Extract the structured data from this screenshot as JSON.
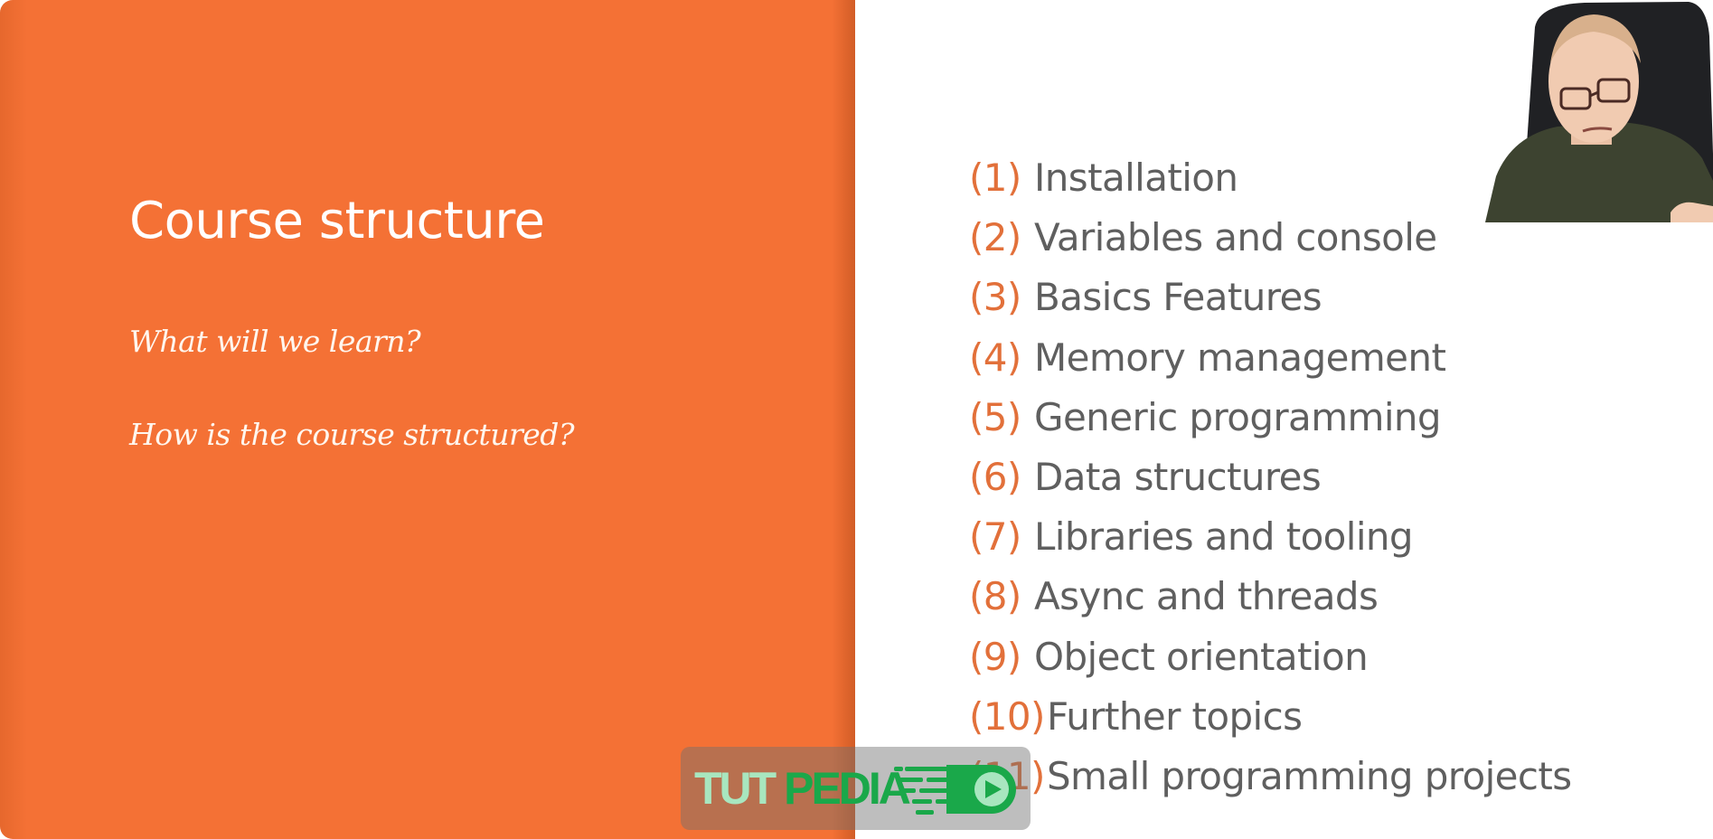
{
  "slide": {
    "title": "Course structure",
    "questions": [
      "What will we learn?",
      "How is the course structured?"
    ],
    "topics": [
      {
        "num": "(1)",
        "label": "Installation"
      },
      {
        "num": "(2)",
        "label": "Variables and console"
      },
      {
        "num": "(3)",
        "label": "Basics Features"
      },
      {
        "num": "(4)",
        "label": "Memory management"
      },
      {
        "num": "(5)",
        "label": "Generic programming"
      },
      {
        "num": "(6)",
        "label": "Data structures"
      },
      {
        "num": "(7)",
        "label": "Libraries and tooling"
      },
      {
        "num": "(8)",
        "label": "Async and threads"
      },
      {
        "num": "(9)",
        "label": "Object orientation"
      },
      {
        "num": "(10)",
        "label": "Further topics"
      },
      {
        "num": "(11)",
        "label": "Small programming projects"
      }
    ],
    "colors": {
      "accent": "#f47135",
      "number": "#e2703a",
      "text": "#5f5f5f"
    }
  },
  "watermark": {
    "part1": "TUT",
    "part2": "PEDIA",
    "icon": "play-icon"
  },
  "webcam": {
    "description": "presenter-webcam"
  }
}
